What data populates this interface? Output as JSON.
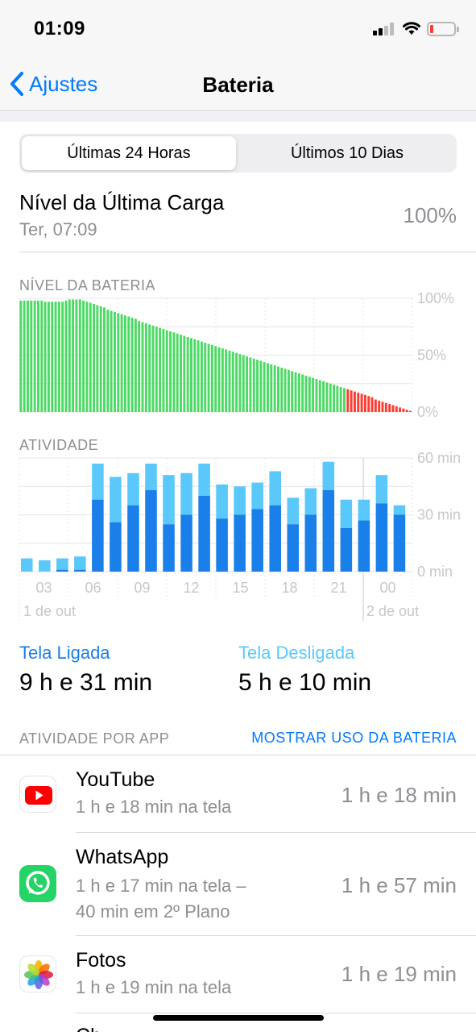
{
  "status_bar": {
    "time": "01:09",
    "battery_color": "#ff3b30"
  },
  "nav": {
    "back_label": "Ajustes",
    "title": "Bateria",
    "back_icon": "chevron-left-icon"
  },
  "segments": [
    {
      "label": "Últimas 24 Horas",
      "selected": true
    },
    {
      "label": "Últimos 10 Dias",
      "selected": false
    }
  ],
  "last_charge": {
    "title": "Nível da Última Carga",
    "date": "Ter, 07:09",
    "value": "100%"
  },
  "battery_section_label": "NÍVEL DA BATERIA",
  "activity_section_label": "ATIVIDADE",
  "colors": {
    "battery_green": "#4cd964",
    "battery_red": "#ff3b30",
    "screen_on": "#1a7fe8",
    "screen_off": "#5ac8fa",
    "accent": "#007aff"
  },
  "chart_data": [
    {
      "type": "bar",
      "title": "NÍVEL DA BATERIA",
      "ylim": [
        0,
        100
      ],
      "ytick_labels": [
        "100%",
        "50%",
        "0%"
      ],
      "grid": true,
      "red_threshold": 20,
      "values": [
        98,
        98,
        98,
        98,
        98,
        98,
        98,
        97,
        97,
        97,
        97,
        97,
        97,
        98,
        99,
        99,
        99,
        99,
        98,
        97,
        96,
        95,
        94,
        93,
        92,
        90,
        89,
        88,
        87,
        86,
        85,
        84,
        83,
        82,
        80,
        79,
        78,
        77,
        76,
        75,
        74,
        73,
        72,
        71,
        70,
        69,
        68,
        67,
        66,
        65,
        64,
        63,
        62,
        61,
        60,
        59,
        58,
        57,
        56,
        55,
        54,
        53,
        52,
        51,
        50,
        49,
        48,
        47,
        46,
        45,
        44,
        43,
        42,
        41,
        40,
        39,
        38,
        37,
        36,
        35,
        34,
        33,
        32,
        31,
        30,
        29,
        28,
        27,
        26,
        25,
        24,
        23,
        22,
        21,
        20,
        19,
        18,
        17,
        16,
        15,
        14,
        13,
        11,
        10,
        9,
        8,
        7,
        6,
        5,
        4,
        3,
        2,
        1
      ]
    },
    {
      "type": "bar",
      "title": "ATIVIDADE",
      "ylim": [
        0,
        60
      ],
      "ytick_labels": [
        "60 min",
        "30 min",
        "0 min"
      ],
      "xtick_labels": [
        "03",
        "06",
        "09",
        "12",
        "15",
        "18",
        "21",
        "00"
      ],
      "date_labels": [
        "1 de out",
        "2 de out"
      ],
      "grid": true,
      "series": [
        {
          "name": "Tela Ligada",
          "values": [
            0,
            0,
            1,
            1,
            38,
            26,
            35,
            43,
            25,
            30,
            40,
            28,
            30,
            33,
            35,
            25,
            30,
            43,
            23,
            27,
            36,
            30
          ]
        },
        {
          "name": "Tela Desligada",
          "values": [
            7,
            6,
            6,
            7,
            19,
            24,
            17,
            14,
            26,
            22,
            17,
            18,
            15,
            14,
            18,
            14,
            14,
            15,
            15,
            11,
            15,
            5
          ]
        }
      ]
    }
  ],
  "screen_time": {
    "on_label": "Tela Ligada",
    "on_value": "9 h e 31 min",
    "off_label": "Tela Desligada",
    "off_value": "5 h e 10 min"
  },
  "app_activity": {
    "header": "ATIVIDADE POR APP",
    "action": "MOSTRAR USO DA BATERIA",
    "apps": [
      {
        "name": "YouTube",
        "detail": "1 h e 18 min na tela",
        "total": "1 h e 18 min",
        "icon": "youtube-icon"
      },
      {
        "name": "WhatsApp",
        "detail": "1 h e 17 min na tela –",
        "detail2": "40 min em 2º Plano",
        "total": "1 h e 57 min",
        "icon": "whatsapp-icon"
      },
      {
        "name": "Fotos",
        "detail": "1 h e 19 min na tela",
        "total": "1 h e 19 min",
        "icon": "photos-icon"
      },
      {
        "name": "Ch",
        "detail": "",
        "total": "",
        "icon": "app-icon"
      }
    ]
  }
}
